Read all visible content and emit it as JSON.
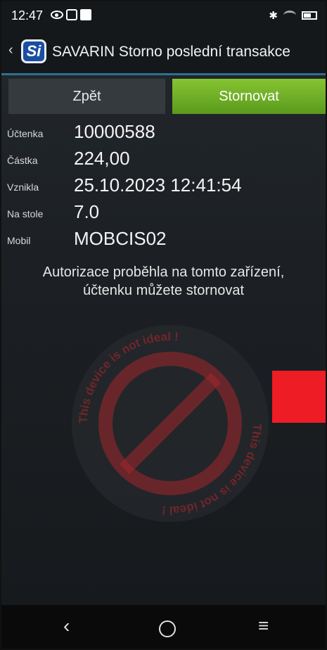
{
  "status_bar": {
    "time": "12:47"
  },
  "action_bar": {
    "logo_text": "Si",
    "title": "SAVARIN Storno poslední transakce"
  },
  "buttons": {
    "back_label": "Zpět",
    "storno_label": "Stornovat",
    "storno_color": "#6fb127"
  },
  "transaction": [
    {
      "label": "Účtenka",
      "value": "10000588"
    },
    {
      "label": "Částka",
      "value": "224,00"
    },
    {
      "label": "Vznikla",
      "value": "25.10.2023 12:41:54"
    },
    {
      "label": "Na stole",
      "value": "7.0"
    },
    {
      "label": "Mobil",
      "value": "MOBCIS02"
    }
  ],
  "message": {
    "line1": "Autorizace proběhla na tomto zařízení,",
    "line2": "účtenku můžete stornovat"
  },
  "watermark": {
    "text": "This device is not ideal !",
    "color": "#c0272d"
  },
  "nav": {
    "back_icon": "nav-back-icon",
    "home_icon": "nav-home-icon",
    "menu_icon": "nav-menu-icon"
  }
}
